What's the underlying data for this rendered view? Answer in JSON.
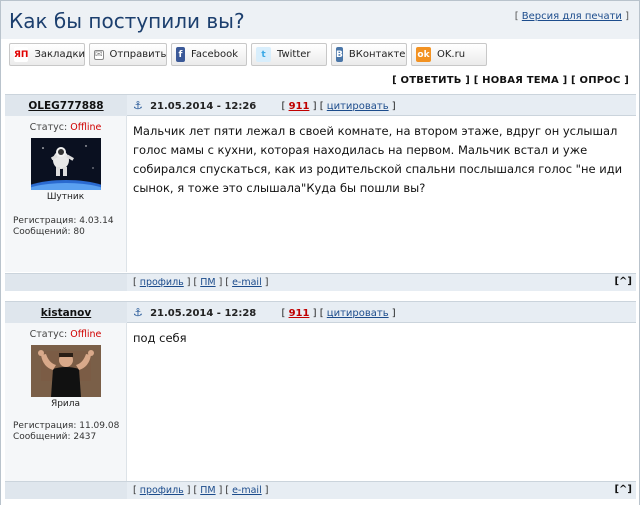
{
  "page": {
    "title": "Как бы поступили вы?",
    "print_prefix": "[ ",
    "print_link": "Версия для печати",
    "print_suffix": " ]"
  },
  "share": [
    {
      "label": "Закладки",
      "icon": "yandex-icon",
      "glyph": "ЯП"
    },
    {
      "label": "Отправить",
      "icon": "mail-icon",
      "glyph": "✉"
    },
    {
      "label": "Facebook",
      "icon": "facebook-icon",
      "glyph": "f"
    },
    {
      "label": "Twitter",
      "icon": "twitter-icon",
      "glyph": "t"
    },
    {
      "label": "ВКонтакте",
      "icon": "vk-icon",
      "glyph": "B"
    },
    {
      "label": "OK.ru",
      "icon": "odnoklassniki-icon",
      "glyph": "ok"
    }
  ],
  "actions": {
    "reply": "[ ОТВЕТИТЬ ]",
    "new_topic": "[ НОВАЯ ТЕМА ]",
    "poll": "[ ОПРОС ]"
  },
  "posts": [
    {
      "author": "OLEG777888",
      "status_label": "Статус:",
      "status_value": "Offline",
      "avatar_caption": "Шутник",
      "registration": "Регистрация: 4.03.14",
      "messages": "Сообщений: 80",
      "date": "21.05.2014 - 12:26",
      "count": "911",
      "quote": "цитировать",
      "text": "Мальчик лет пяти лежал в своей комнате, на втором этаже, вдруг он услышал голос мамы с кухни, которая находилась на первом. Мальчик встал и уже собирался спускаться, как из родительской спальни послышался голос \"не иди сынок, я тоже это слышала\"Куда бы пошли вы?",
      "profile": "профиль",
      "pm": "ПМ",
      "email": "e-mail"
    },
    {
      "author": "kistanov",
      "status_label": "Статус:",
      "status_value": "Offline",
      "avatar_caption": "Ярила",
      "registration": "Регистрация: 11.09.08",
      "messages": "Сообщений: 2437",
      "date": "21.05.2014 - 12:28",
      "count": "911",
      "quote": "цитировать",
      "text": "под себя",
      "profile": "профиль",
      "pm": "ПМ",
      "email": "e-mail"
    }
  ],
  "up_label": "[^]",
  "colors": {
    "title": "#1c3f6e",
    "header_bg": "#e7edf3",
    "offline": "#d00000",
    "count": "#c00000"
  }
}
